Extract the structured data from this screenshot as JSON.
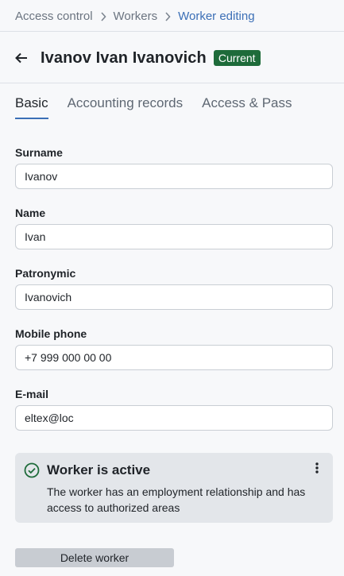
{
  "breadcrumb": {
    "items": [
      "Access control",
      "Workers",
      "Worker editing"
    ]
  },
  "header": {
    "title": "Ivanov Ivan Ivanovich",
    "status_badge": "Current"
  },
  "tabs": [
    {
      "label": "Basic",
      "active": true
    },
    {
      "label": "Accounting records",
      "active": false
    },
    {
      "label": "Access & Pass",
      "active": false
    }
  ],
  "form": {
    "surname": {
      "label": "Surname",
      "value": "Ivanov"
    },
    "name": {
      "label": "Name",
      "value": "Ivan"
    },
    "patronymic": {
      "label": "Patronymic",
      "value": "Ivanovich"
    },
    "mobile_phone": {
      "label": "Mobile phone",
      "value": "+7 999 000 00 00"
    },
    "email": {
      "label": "E-mail",
      "value": "eltex@loc"
    }
  },
  "status_card": {
    "title": "Worker is active",
    "text": "The worker has an employment relationship and has access to authorized areas"
  },
  "actions": {
    "delete_label": "Delete worker"
  },
  "colors": {
    "accent": "#3b6fb6",
    "badge": "#1e6b3a",
    "status_ok": "#1e6b3a"
  },
  "icons": {
    "back": "arrow-left-icon",
    "breadcrumb_sep": "chevron-right-icon",
    "status": "check-circle-icon",
    "more": "more-vertical-icon"
  }
}
